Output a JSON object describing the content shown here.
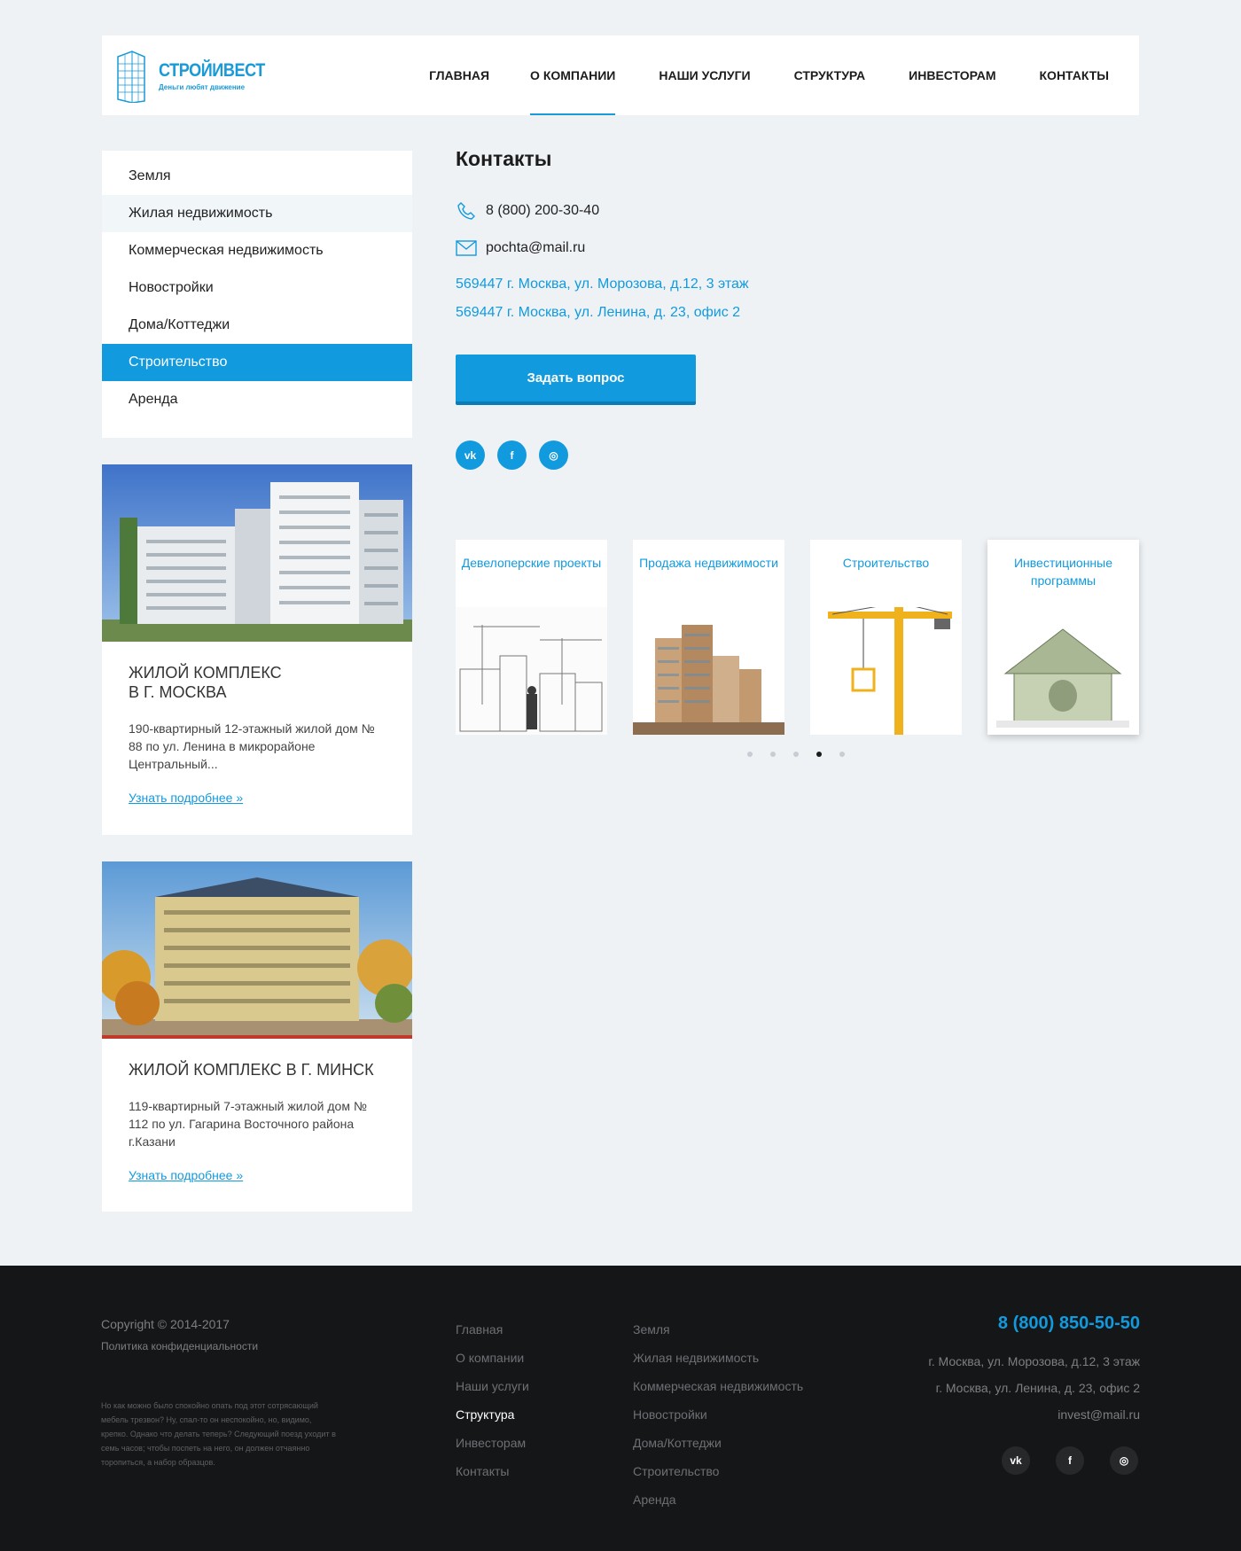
{
  "header": {
    "logo_title": "СТРОЙИВЕСТ",
    "logo_tagline": "Деньги любят движение",
    "nav": [
      {
        "label": "ГЛАВНАЯ"
      },
      {
        "label": "О КОМПАНИИ",
        "active": true
      },
      {
        "label": "НАШИ УСЛУГИ"
      },
      {
        "label": "СТРУКТУРА"
      },
      {
        "label": "ИНВЕСТОРАМ"
      },
      {
        "label": "КОНТАКТЫ"
      }
    ]
  },
  "sidebar": {
    "items": [
      {
        "label": "Земля"
      },
      {
        "label": "Жилая недвижимость",
        "state": "hover"
      },
      {
        "label": "Коммерческая недвижимость"
      },
      {
        "label": "Новостройки"
      },
      {
        "label": "Дома/Коттеджи"
      },
      {
        "label": "Строительство",
        "state": "active"
      },
      {
        "label": "Аренда"
      }
    ],
    "cards": [
      {
        "title": "ЖИЛОЙ КОМПЛЕКС\nВ Г. МОСКВА",
        "text": "190-квартирный 12-этажный жилой дом № 88 по ул. Ленина в микрорайоне Центральный...",
        "link": "Узнать подробнее »"
      },
      {
        "title": "ЖИЛОЙ КОМПЛЕКС В Г. МИНСК",
        "text": "119-квартирный 7-этажный жилой дом № 112 по ул. Гагарина Восточного района г.Казани",
        "link": "Узнать подробнее »"
      }
    ]
  },
  "main": {
    "title": "Контакты",
    "phone": "8 (800) 200-30-40",
    "email": "pochta@mail.ru",
    "addresses": [
      "569447 г. Москва, ул. Морозова, д.12, 3 этаж",
      "569447 г. Москва, ул. Ленина, д. 23, офис 2"
    ],
    "ask_button": "Задать вопрос",
    "social": [
      {
        "icon": "vk-icon",
        "glyph": "vk"
      },
      {
        "icon": "facebook-icon",
        "glyph": "f"
      },
      {
        "icon": "instagram-icon",
        "glyph": "◎"
      }
    ],
    "services": [
      {
        "label": "Девелоперские проекты"
      },
      {
        "label": "Продажа недвижимости"
      },
      {
        "label": "Строительство"
      },
      {
        "label": "Инвестиционные программы"
      }
    ],
    "carousel": {
      "pages": 5,
      "active_index": 4
    }
  },
  "footer": {
    "copyright": "Copyright © 2014-2017",
    "policy": "Политика конфиденциальности",
    "description": "Но как можно было спокойно опать под этот сотрясающий мебель трезвон? Ну, спал-то он неспокойно, но, видимо, крепко. Однако что делать теперь? Следующий поезд уходит в семь часов; чтобы поспеть на него, он должен отчаянно торопиться, а набор образцов.",
    "nav_col1": [
      {
        "label": "Главная"
      },
      {
        "label": "О компании"
      },
      {
        "label": "Наши услуги"
      },
      {
        "label": "Структура",
        "active": true
      },
      {
        "label": "Инвесторам"
      },
      {
        "label": "Контакты"
      }
    ],
    "nav_col2": [
      {
        "label": "Земля"
      },
      {
        "label": "Жилая недвижимость"
      },
      {
        "label": "Коммерческая недвижимость"
      },
      {
        "label": "Новостройки"
      },
      {
        "label": "Дома/Коттеджи"
      },
      {
        "label": "Строительство"
      },
      {
        "label": "Аренда"
      }
    ],
    "phone": "8 (800) 850-50-50",
    "address1": "г. Москва, ул. Морозова, д.12, 3 этаж",
    "address2": "г. Москва, ул. Ленина, д. 23, офис 2",
    "email": "invest@mail.ru",
    "social": [
      {
        "icon": "vk-icon",
        "glyph": "vk"
      },
      {
        "icon": "facebook-icon",
        "glyph": "f"
      },
      {
        "icon": "instagram-icon",
        "glyph": "◎"
      }
    ]
  },
  "colors": {
    "accent": "#129ade",
    "background": "#eef2f5",
    "footer": "#151617"
  }
}
